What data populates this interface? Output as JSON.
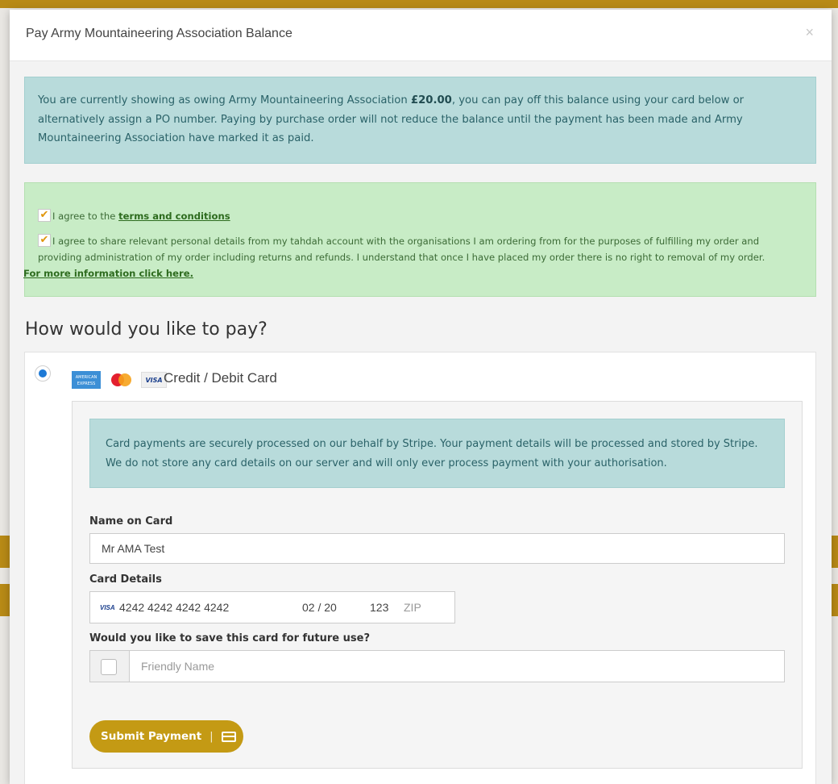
{
  "modal": {
    "title": "Pay Army Mountaineering Association Balance",
    "close_glyph": "×"
  },
  "balance_notice": {
    "text_before": "You are currently showing as owing Army Mountaineering Association ",
    "amount": "£20.00",
    "text_after": ", you can pay off this balance using your card below or alternatively assign a PO number. Paying by purchase order will not reduce the balance until the payment has been made and Army Mountaineering Association have marked it as paid."
  },
  "agreements": {
    "terms_prefix": "I agree to the ",
    "terms_link": "terms and conditions",
    "share_text": "I agree to share relevant personal details from my tahdah account with the organisations I am ordering from for the purposes of fulfilling my order and providing administration of my order including returns and refunds. I understand that once I have placed my order there is no right to removal of my order.",
    "more_info_link": "For more information click here.",
    "check_glyph": "✔"
  },
  "payment": {
    "heading": "How would you like to pay?",
    "method_label": "Credit / Debit Card",
    "logos": [
      "amex-logo",
      "mastercard-logo",
      "visa-logo"
    ],
    "amex_text": "AMERICAN EXPRESS",
    "visa_text": "VISA",
    "stripe_notice": "Card payments are securely processed on our behalf by Stripe. Your payment details will be processed and stored by Stripe. We do not store any card details on our server and will only ever process payment with your authorisation.",
    "name_label": "Name on Card",
    "name_value": "Mr AMA Test",
    "card_label": "Card Details",
    "card_number": "4242 4242 4242 4242",
    "card_expiry": "02 / 20",
    "card_cvc": "123",
    "card_zip_placeholder": "ZIP",
    "save_label": "Would you like to save this card for future use?",
    "friendly_placeholder": "Friendly Name",
    "submit_label": "Submit Payment",
    "submit_separator": "|"
  },
  "colors": {
    "accent": "#c49a14",
    "info_bg": "#b8dbdb",
    "success_bg": "#c8ecc6",
    "radio_selected": "#1e7ad6"
  }
}
